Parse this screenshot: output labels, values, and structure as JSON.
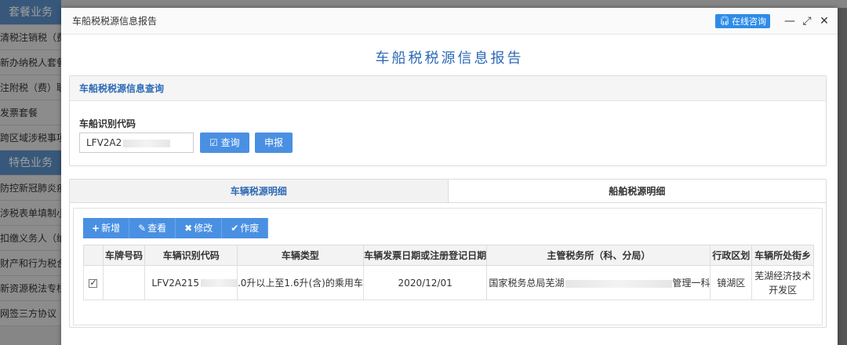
{
  "background": {
    "sidebar_items": [
      {
        "label": "套餐业务",
        "header": true
      },
      {
        "label": "清税注销税（费",
        "header": false
      },
      {
        "label": "新办纳税人套餐",
        "header": false
      },
      {
        "label": "注附税（费）联",
        "header": false
      },
      {
        "label": "发票套餐",
        "header": false
      },
      {
        "label": "跨区域涉税事项",
        "header": false
      },
      {
        "label": "特色业务",
        "header": true
      },
      {
        "label": "防控新冠肺炎疫",
        "header": false
      },
      {
        "label": "涉税表单填制小",
        "header": false
      },
      {
        "label": "扣缴义务人（纳",
        "header": false
      },
      {
        "label": "财产和行为税合",
        "header": false
      },
      {
        "label": "新资源税法专栏",
        "header": false
      },
      {
        "label": "网签三方协议",
        "header": false
      }
    ]
  },
  "modal": {
    "window_title": "车船税税源信息报告",
    "consult_label": "在线咨询",
    "minimize_icon": "—",
    "maximize_icon": "⤢",
    "close_icon": "✕",
    "report_title": "车船税税源信息报告"
  },
  "query_panel": {
    "title": "车船税税源信息查询",
    "field_label": "车船识别代码",
    "field_value": "LFV2A2",
    "query_button": "查询",
    "declare_button": "申报"
  },
  "detail_panel": {
    "tabs": [
      {
        "label": "车辆税源明细",
        "active": true
      },
      {
        "label": "船舶税源明细",
        "active": false
      }
    ],
    "toolbar": [
      {
        "icon": "+",
        "label": "新增"
      },
      {
        "icon": "✎",
        "label": "查看"
      },
      {
        "icon": "✖",
        "label": "修改"
      },
      {
        "icon": "✔",
        "label": "作废"
      }
    ],
    "columns": [
      "",
      "车牌号码",
      "车辆识别代码",
      "车辆类型",
      "车辆发票日期或注册登记日期",
      "主管税务所（科、分局）",
      "行政区划",
      "车辆所处街乡"
    ],
    "rows": [
      {
        "checked": true,
        "plate": "",
        "vin": "LFV2A215",
        "vehicle_type": ".0升以上至1.6升(含)的乘用车",
        "date": "2020/12/01",
        "tax_office_prefix": "国家税务总局芜湖",
        "tax_office_suffix": "管理一科",
        "district": "镜湖区",
        "street": "芜湖经济技术开发区"
      }
    ]
  },
  "colors": {
    "accent": "#2d6ab5",
    "button": "#4a90e2",
    "sidebar_header": "#5a8fc6"
  }
}
